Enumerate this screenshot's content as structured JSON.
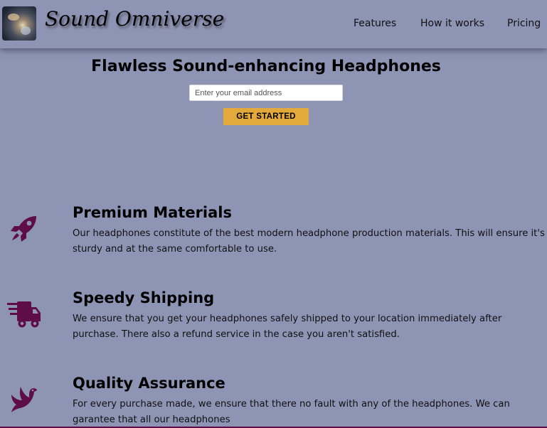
{
  "header": {
    "logo_icon": "headphones-photo",
    "brand_name": "Sound Omniverse",
    "nav": [
      "Features",
      "How it works",
      "Pricing"
    ]
  },
  "hero": {
    "title": "Flawless Sound-enhancing Headphones",
    "email_placeholder": "Enter your email address",
    "email_value": "",
    "cta_label": "GET STARTED"
  },
  "features": [
    {
      "icon": "rocket-icon",
      "title": "Premium Materials",
      "text": "Our headphones constitute of the best modern headphone production materials. This will ensure it's sturdy and at the same comfortable to use."
    },
    {
      "icon": "shipping-truck-icon",
      "title": "Speedy Shipping",
      "text": "We ensure that you get your headphones safely shipped to your location immediately after purchase. There also a refund service in the case you aren't satisfied."
    },
    {
      "icon": "dove-icon",
      "title": "Quality Assurance",
      "text": "For every purchase made, we ensure that there no fault with any of the headphones. We can garantee that all our headphones"
    }
  ],
  "colors": {
    "background": "#8e94b3",
    "accent_button": "#e3a93a",
    "icon_color": "#5f0d4a"
  }
}
